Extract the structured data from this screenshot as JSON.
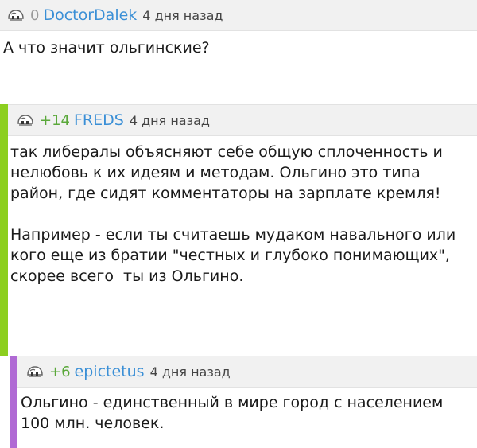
{
  "comments": [
    {
      "rating": "0",
      "username": "DoctorDalek",
      "time": "4 дня назад",
      "text": "А что значит ольгинские?"
    },
    {
      "rating": "+14",
      "username": "FREDS",
      "time": "4 дня назад",
      "text": "так либералы объясняют себе общую сплоченность и нелюбовь к их идеям и методам. Ольгино это типа район, где сидят комментаторы на зарплате кремля!\n\nНапример - если ты считаешь мудаком навального или кого еще из братии \"честных и глубоко понимающих\", скорее всего  ты из Ольгино."
    },
    {
      "rating": "+6",
      "username": "epictetus",
      "time": "4 дня назад",
      "text": "Ольгино - единственный в мире город с населением 100 млн. человек."
    }
  ],
  "colors": {
    "thread_level_1": "#8ccf1f",
    "thread_level_2": "#b06ad4",
    "username": "#3a8fd6",
    "positive_rating": "#5aa83a"
  },
  "icons": {
    "avatar": "avatar-face-icon"
  }
}
